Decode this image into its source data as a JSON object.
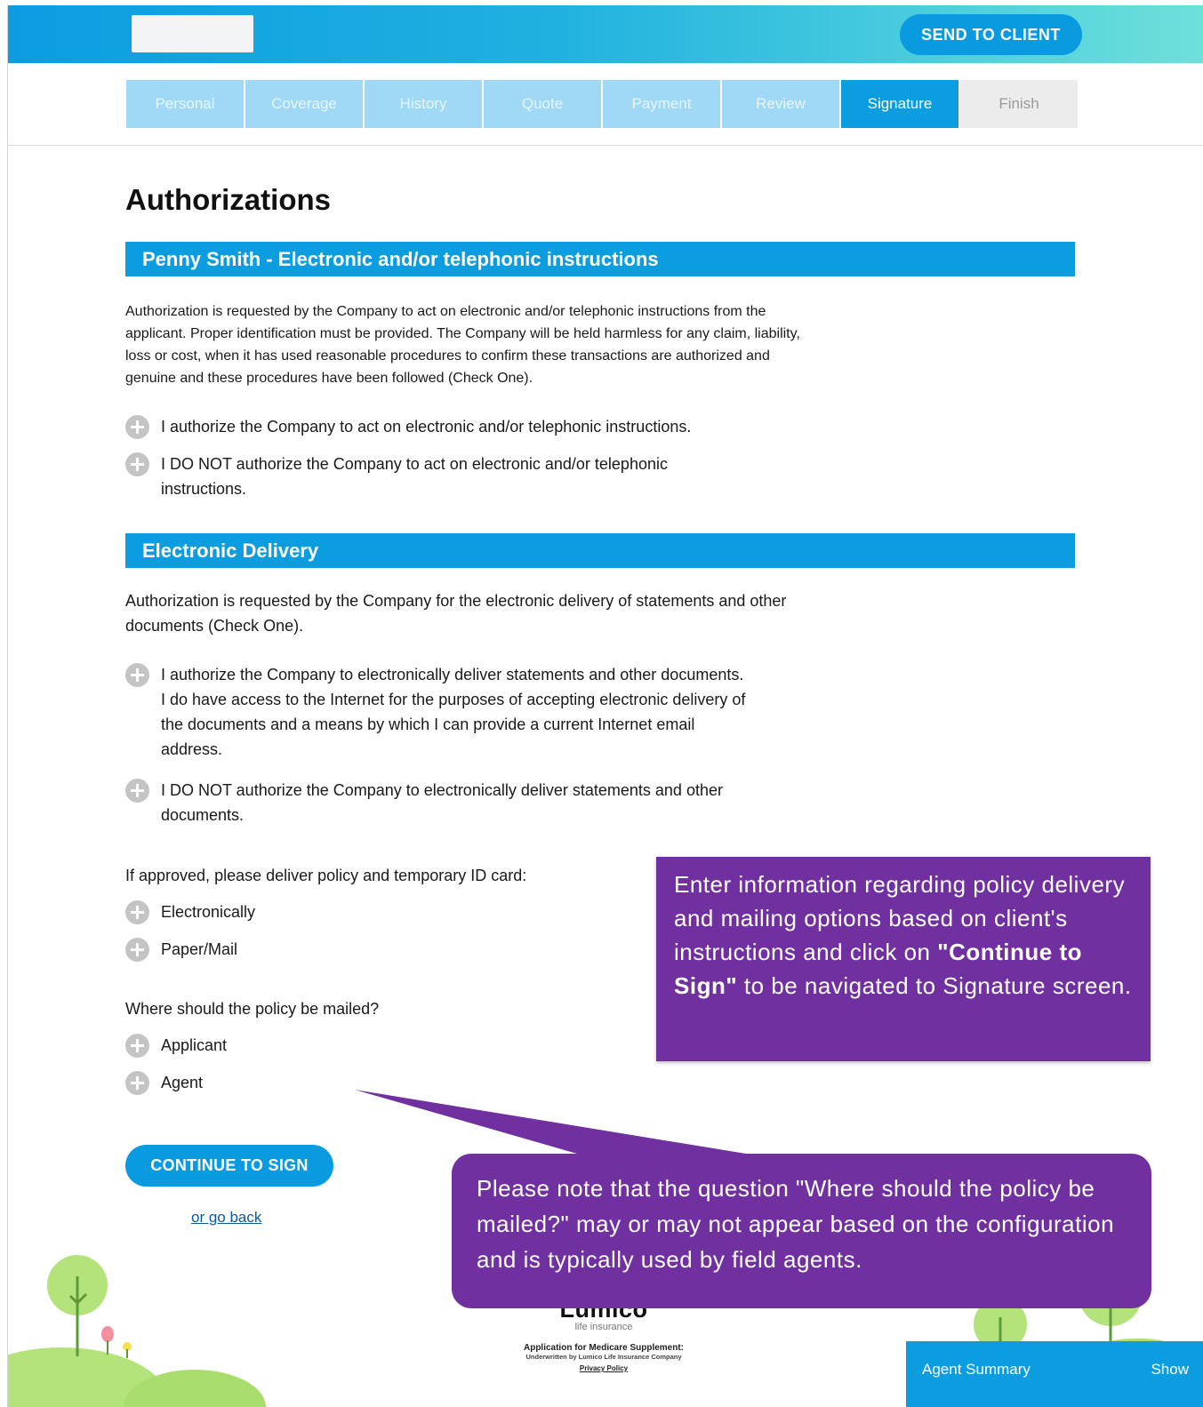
{
  "header": {
    "send_label": "SEND TO CLIENT"
  },
  "steps": [
    {
      "label": "Personal",
      "state": "done"
    },
    {
      "label": "Coverage",
      "state": "done"
    },
    {
      "label": "History",
      "state": "done"
    },
    {
      "label": "Quote",
      "state": "done"
    },
    {
      "label": "Payment",
      "state": "done"
    },
    {
      "label": "Review",
      "state": "done"
    },
    {
      "label": "Signature",
      "state": "active"
    },
    {
      "label": "Finish",
      "state": "future"
    }
  ],
  "page_title": "Authorizations",
  "section1": {
    "heading": "Penny Smith - Electronic and/or telephonic instructions",
    "paragraph": "Authorization is requested by the Company to act on electronic and/or telephonic instructions from the applicant. Proper identification must be provided. The Company will be held harmless for any claim, liability, loss or cost, when it has used reasonable procedures to confirm these transactions are authorized and genuine and these procedures have been followed (Check One).",
    "options": [
      "I authorize the Company to act on electronic and/or telephonic instructions.",
      "I DO NOT authorize the Company to act on electronic and/or telephonic instructions."
    ]
  },
  "section2": {
    "heading": "Electronic Delivery",
    "paragraph": "Authorization is requested by the Company for the electronic delivery of statements and other documents (Check One).",
    "options": [
      "I authorize the Company to electronically deliver statements and other documents. I do have access to the Internet for the purposes of accepting electronic delivery of the documents and a means by which I can provide a current Internet email address.",
      "I DO NOT authorize the Company to electronically deliver statements and other documents."
    ]
  },
  "delivery": {
    "question": "If approved, please deliver policy and temporary ID card:",
    "options": [
      "Electronically",
      "Paper/Mail"
    ]
  },
  "mailing": {
    "question": "Where should the policy be mailed?",
    "options": [
      "Applicant",
      "Agent"
    ]
  },
  "actions": {
    "continue_label": "CONTINUE TO SIGN",
    "go_back_label": "or go back"
  },
  "callouts": {
    "first_pre": "Enter information regarding policy delivery and mailing options based on client's instructions and click on ",
    "first_bold": "\"Continue to Sign\"",
    "first_post": " to be navigated to Signature screen.",
    "second": "Please note that the question \"Where should the policy be mailed?\" may or may not appear based on the configuration and is typically used by field agents."
  },
  "footer": {
    "brand": "Lumico",
    "brand_sub": "life insurance",
    "app_line": "Application for Medicare Supplement:",
    "underwritten": "Underwritten by Lumico Life Insurance Company",
    "privacy": "Privacy Policy"
  },
  "agent_summary": {
    "label": "Agent Summary",
    "toggle": "Show"
  },
  "colors": {
    "accent": "#0b9de0",
    "callout": "#7030a0",
    "step_done": "#9fd9f6",
    "step_future": "#ececec"
  }
}
